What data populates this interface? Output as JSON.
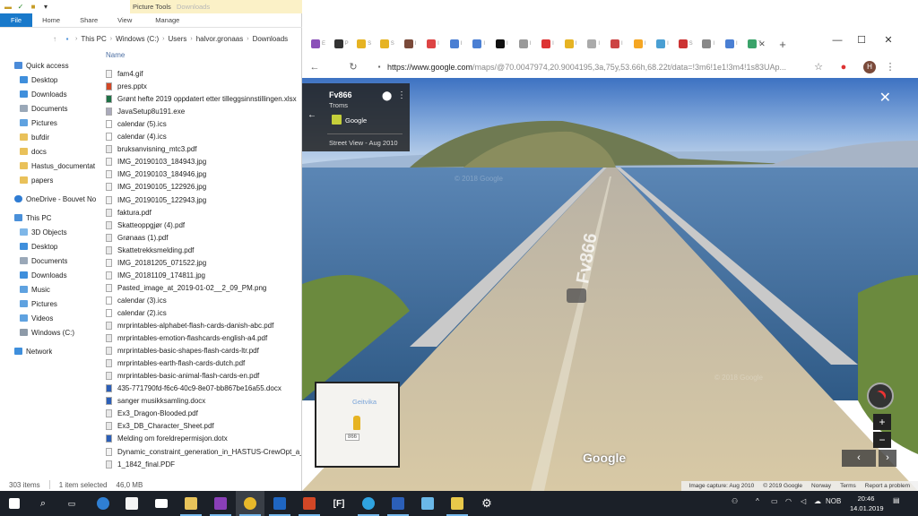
{
  "explorer": {
    "context_tab": "Picture Tools",
    "context_title": "Downloads",
    "ribbon_tabs": [
      "File",
      "Home",
      "Share",
      "View",
      "Manage"
    ],
    "breadcrumbs": [
      "This PC",
      "Windows (C:)",
      "Users",
      "halvor.gronaas",
      "Downloads"
    ],
    "column_name": "Name",
    "nav": {
      "quick_access": "Quick access",
      "desktop": "Desktop",
      "downloads": "Downloads",
      "documents": "Documents",
      "pictures": "Pictures",
      "bufdir": "bufdir",
      "docs": "docs",
      "hastus": "Hastus_documentat",
      "papers": "papers",
      "onedrive": "OneDrive - Bouvet No",
      "this_pc": "This PC",
      "objects3d": "3D Objects",
      "desktop2": "Desktop",
      "documents2": "Documents",
      "downloads2": "Downloads",
      "music": "Music",
      "pictures2": "Pictures",
      "videos": "Videos",
      "windows_c": "Windows (C:)",
      "network": "Network"
    },
    "files": [
      "fam4.gif",
      "pres.pptx",
      "Grønt hefte 2019 oppdatert etter tilleggsinnstillingen.xlsx",
      "JavaSetup8u191.exe",
      "calendar (5).ics",
      "calendar (4).ics",
      "bruksanvisning_mtc3.pdf",
      "IMG_20190103_184943.jpg",
      "IMG_20190103_184946.jpg",
      "IMG_20190105_122926.jpg",
      "IMG_20190105_122943.jpg",
      "faktura.pdf",
      "Skatteoppgjør (4).pdf",
      "Grønaas (1).pdf",
      "Skattetrekksmelding.pdf",
      "IMG_20181205_071522.jpg",
      "IMG_20181109_174811.jpg",
      "Pasted_image_at_2019-01-02__2_09_PM.png",
      "calendar (3).ics",
      "calendar (2).ics",
      "mrprintables-alphabet-flash-cards-danish-abc.pdf",
      "mrprintables-emotion-flashcards-english-a4.pdf",
      "mrprintables-basic-shapes-flash-cards-ltr.pdf",
      "mrprintables-earth-flash-cards-dutch.pdf",
      "mrprintables-basic-animal-flash-cards-en.pdf",
      "435-771790fd-f6c6-40c9-8e07-bb867be16a55.docx",
      "sanger musikksamling.docx",
      "Ex3_Dragon-Blooded.pdf",
      "Ex3_DB_Character_Sheet.pdf",
      "Melding om foreldrepermisjon.dotx",
      "Dynamic_constraint_generation_in_HASTUS-CrewOpt_a_p",
      "1_1842_final.PDF"
    ],
    "status": {
      "count": "303 items",
      "selected": "1 item selected",
      "size": "46,0 MB"
    }
  },
  "chrome": {
    "tab_letters": [
      "E",
      "P",
      "S",
      "S",
      "I",
      "I",
      "I",
      "I",
      "I",
      "I",
      "I",
      "I",
      "I",
      "I",
      "I",
      "I",
      "S",
      "I",
      "I",
      "T"
    ],
    "url_host": "https://www.google.com",
    "url_path": "/maps/@70.0047974,20.9004195,3a,75y,53.66h,68.22t/data=!3m6!1e1!3m4!1s83UAp...",
    "profile_letter": "H",
    "streetview": {
      "place_name": "Fv866",
      "region": "Troms",
      "source": "Google",
      "date": "Street View - Aug 2010",
      "road_marking": "Fv866",
      "minimap_place": "Geitvika",
      "minimap_road": "866",
      "logo": "Google",
      "watermark": "© 2018 Google",
      "attribution": [
        "Image capture: Aug 2010",
        "© 2019 Google",
        "Norway",
        "Terms",
        "Send a report a problem"
      ],
      "attribution_labels": {
        "capture": "Image capture: Aug 2010",
        "copyright": "© 2019 Google",
        "country": "Norway",
        "terms": "Terms",
        "report": "Report a problem"
      }
    }
  },
  "taskbar": {
    "tray_lang": "NOB",
    "time": "20:46",
    "date": "14.01.2019"
  },
  "colors": {
    "file_tab": "#1979ca",
    "taskbar": "#1b2028",
    "sky_top": "#4f82c6",
    "sea": "#3f6f9e"
  }
}
